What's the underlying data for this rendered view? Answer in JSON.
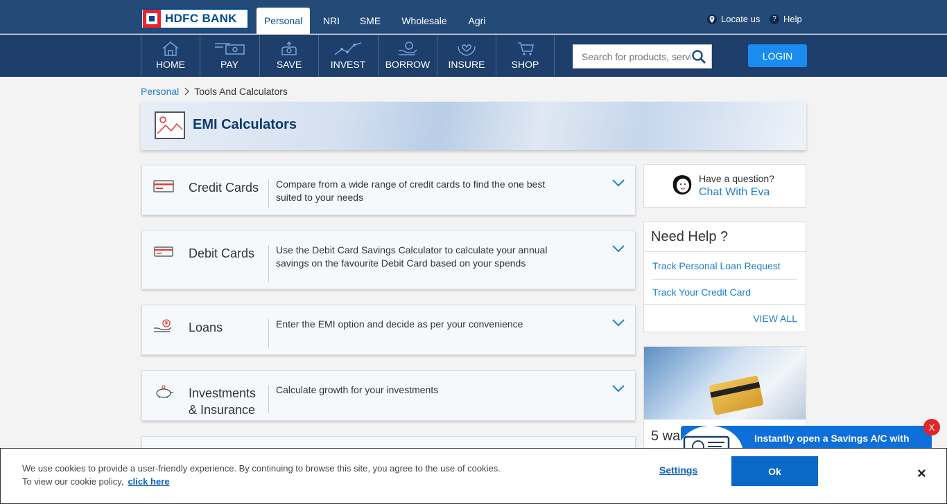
{
  "brand": {
    "logo_text": "HDFC BANK"
  },
  "segments": [
    {
      "label": "Personal",
      "active": true
    },
    {
      "label": "NRI"
    },
    {
      "label": "SME"
    },
    {
      "label": "Wholesale"
    },
    {
      "label": "Agri"
    }
  ],
  "utility": {
    "locate": "Locate us",
    "help": "Help"
  },
  "nav": [
    "HOME",
    "PAY",
    "SAVE",
    "INVEST",
    "BORROW",
    "INSURE",
    "SHOP"
  ],
  "search": {
    "placeholder": "Search for products, servi..."
  },
  "login_label": "LOGIN",
  "breadcrumb": {
    "root": "Personal",
    "current": "Tools And Calculators"
  },
  "banner": {
    "title": "EMI Calculators"
  },
  "calculators": [
    {
      "title": "Credit Cards",
      "description": "Compare from a wide range of credit cards to find the one best suited to your needs"
    },
    {
      "title": "Debit Cards",
      "description": "Use the Debit Card Savings Calculator to calculate your annual savings on the favourite Debit Card based on your spends"
    },
    {
      "title": "Loans",
      "description": "Enter the EMI option and decide as per your convenience"
    },
    {
      "title": "Investments & Insurance",
      "description": "Calculate growth for your investments"
    }
  ],
  "eva": {
    "question": "Have a question?",
    "link": "Chat With Eva"
  },
  "need_help": {
    "title": "Need Help ?",
    "links": [
      "Track Personal Loan Request",
      "Track Your Credit Card"
    ],
    "view_all": "VIEW ALL"
  },
  "promo": {
    "text": "5 wa"
  },
  "savings_popup": {
    "text": "Instantly open a Savings A/C with",
    "close": "X"
  },
  "cookie": {
    "text": "We use cookies to provide a user-friendly experience. By continuing to browse this site, you agree to the use of cookies. To view our cookie policy,",
    "link": "click here",
    "settings": "Settings",
    "ok": "Ok",
    "close": "×"
  },
  "colors": {
    "topbar": "#244a78",
    "mainnav": "#1e3e6c",
    "accent": "#1a8cf0",
    "link": "#1d7ed2"
  }
}
